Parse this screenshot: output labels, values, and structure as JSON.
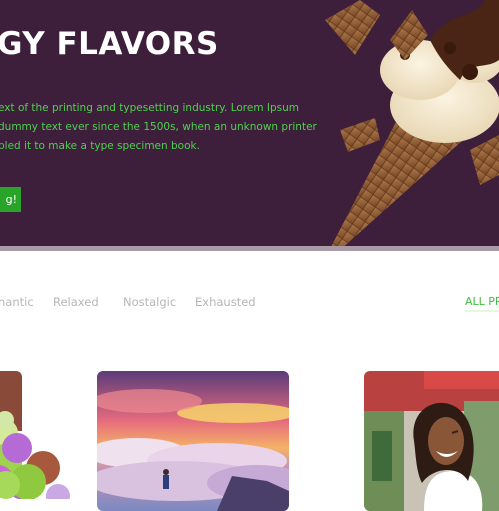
{
  "hero": {
    "title": "GY FLAVORS",
    "text_lines": [
      "ext of the printing and typesetting industry. Lorem Ipsum",
      "dummy text ever since the 1500s, when an unknown printer",
      "bled it to make a type specimen book."
    ],
    "cta_label": "g!"
  },
  "filters": {
    "tabs": [
      "nantic",
      "Relaxed",
      "Nostalgic",
      "Exhausted"
    ],
    "all_label": "ALL PR"
  },
  "colors": {
    "hero_bg": "#3d1f3c",
    "accent_green": "#4ed14e",
    "button_green": "#28a428"
  },
  "cards": [
    {
      "image": "ice-cream-scoops-photo"
    },
    {
      "image": "sunset-clouds-photo"
    },
    {
      "image": "laughing-woman-photo"
    }
  ]
}
